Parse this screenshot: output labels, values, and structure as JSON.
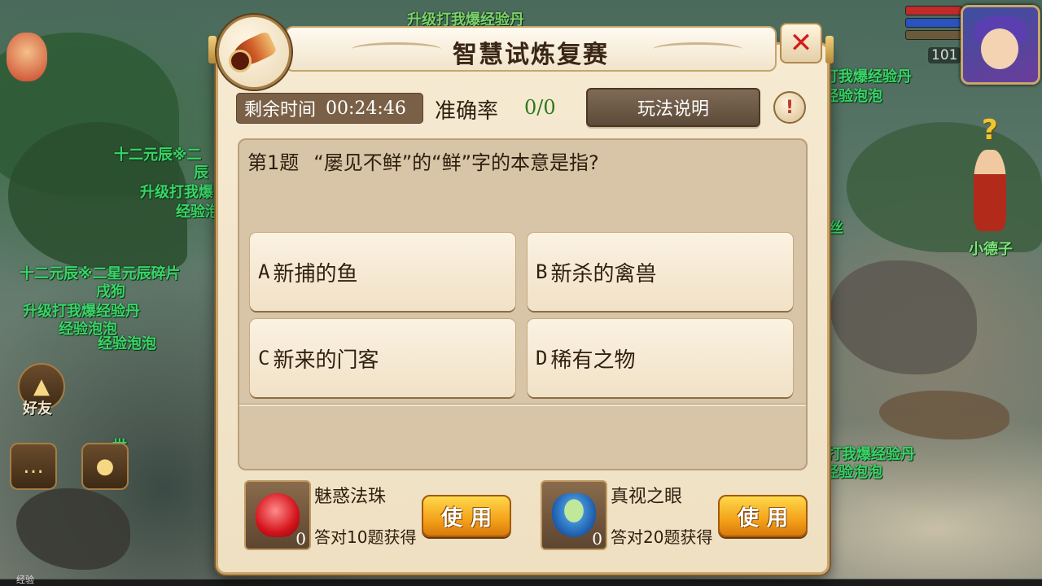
{
  "dialog": {
    "title": "智慧试炼复赛",
    "timer_label": "剩余时间",
    "timer_value": "00:24:46",
    "accuracy_label": "准确率",
    "accuracy_value": "0/0",
    "rules_button": "玩法说明",
    "info_button": "!",
    "close_button": "✕"
  },
  "question": {
    "number": "第1题",
    "text": "“屡见不鲜”的“鲜”字的本意是指?",
    "options": [
      {
        "letter": "A",
        "text": "新捕的鱼"
      },
      {
        "letter": "B",
        "text": "新杀的禽兽"
      },
      {
        "letter": "C",
        "text": "新来的门客"
      },
      {
        "letter": "D",
        "text": "稀有之物"
      }
    ]
  },
  "items": [
    {
      "name": "魅惑法珠",
      "condition": "答对10题获得",
      "count": "0",
      "button": "使用",
      "icon": "red-heart-orb-icon"
    },
    {
      "name": "真视之眼",
      "condition": "答对20题获得",
      "count": "0",
      "button": "使用",
      "icon": "blue-bowl-icon"
    }
  ],
  "hud": {
    "level": "101",
    "friends_label": "好友",
    "xp_label": "经验",
    "npc_name": "小德子",
    "world_labels": [
      "十二元辰※二",
      "辰",
      "升级打我爆",
      "经验泡",
      "十二元辰※二星元辰碎片",
      "戌狗",
      "升级打我爆经验丹",
      "经验泡泡",
      "经验泡泡",
      "打我爆经验丹",
      "经验泡泡",
      "打我爆经验丹",
      "经验泡泡",
      "升级打我爆经验丹",
      "世",
      "丝"
    ]
  },
  "colors": {
    "accent": "#c8a46a",
    "accuracy_green": "#2c7a1c",
    "close_red": "#d21c1c",
    "use_button_orange": "#f3a11a",
    "world_text_green": "#3bd46a"
  }
}
